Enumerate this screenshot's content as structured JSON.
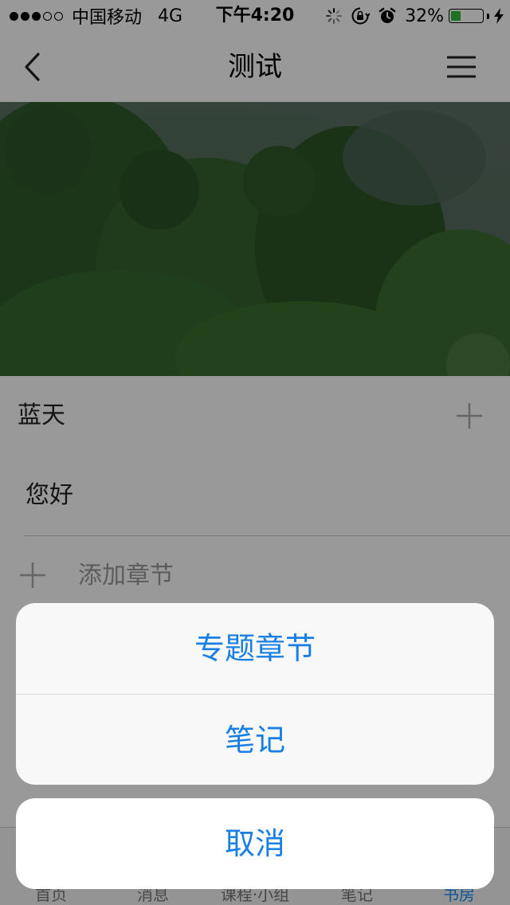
{
  "status_bar": {
    "carrier": "中国移动",
    "network": "4G",
    "time": "下午4:20",
    "battery_percent_label": "32%",
    "battery_level": 0.32,
    "icons": [
      "signal-dots-icon",
      "activity-spinner-icon",
      "rotation-lock-icon",
      "alarm-icon",
      "battery-icon",
      "charging-bolt-icon"
    ]
  },
  "nav": {
    "title": "测试",
    "back_icon": "chevron-left-icon",
    "menu_icon": "hamburger-menu-icon"
  },
  "list": {
    "section_title": "蓝天",
    "chapter_title": "您好",
    "add_chapter_label": "添加章节"
  },
  "tab_bar": {
    "items": [
      {
        "label": "首页",
        "icon": "home-icon",
        "active": false
      },
      {
        "label": "消息",
        "icon": "message-icon",
        "active": false
      },
      {
        "label": "课程·小组",
        "icon": "course-icon",
        "active": false
      },
      {
        "label": "笔记",
        "icon": "note-icon",
        "active": false
      },
      {
        "label": "书房",
        "icon": "study-icon",
        "active": true
      }
    ]
  },
  "action_sheet": {
    "options": [
      "专题章节",
      "笔记"
    ],
    "cancel_label": "取消"
  },
  "colors": {
    "accent": "#1a7fe3",
    "battery_green": "#2fbf36",
    "overlay": "rgba(0,0,0,0.40)"
  }
}
